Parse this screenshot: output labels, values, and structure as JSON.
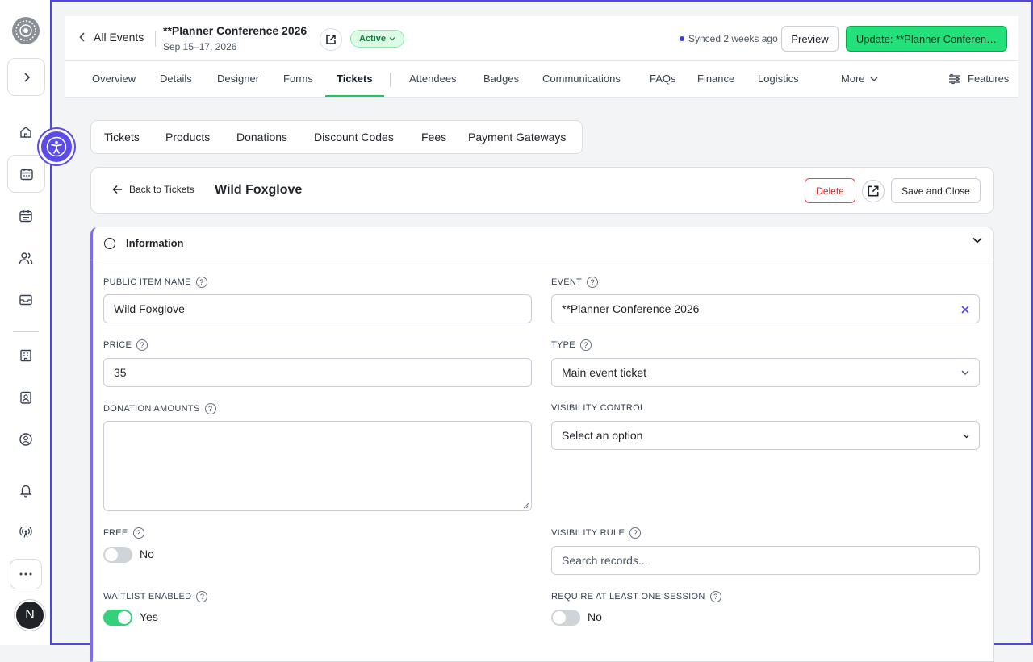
{
  "header": {
    "back_label": "All Events",
    "event_title": "**Planner Conference 2026",
    "event_dates": "Sep 15–17, 2026",
    "status": "Active",
    "synced_text": "Synced 2 weeks ago",
    "preview_label": "Preview",
    "update_label": "Update: **Planner Conferen…"
  },
  "nav": {
    "items": [
      "Overview",
      "Details",
      "Designer",
      "Forms",
      "Tickets",
      "Attendees",
      "Badges",
      "Communications",
      "FAQs",
      "Finance",
      "Logistics",
      "More"
    ],
    "active": "Tickets",
    "features_label": "Features"
  },
  "subtabs": [
    "Tickets",
    "Products",
    "Donations",
    "Discount Codes",
    "Fees",
    "Payment Gateways"
  ],
  "item_bar": {
    "back_label": "Back to Tickets",
    "title": "Wild Foxglove",
    "delete_label": "Delete",
    "save_label": "Save and Close"
  },
  "section": {
    "title": "Information"
  },
  "form": {
    "public_item_name": {
      "label": "PUBLIC ITEM NAME",
      "value": "Wild Foxglove"
    },
    "event": {
      "label": "EVENT",
      "value": "**Planner Conference 2026"
    },
    "price": {
      "label": "PRICE",
      "value": "35"
    },
    "type": {
      "label": "TYPE",
      "value": "Main event ticket"
    },
    "donation_amounts": {
      "label": "DONATION AMOUNTS",
      "value": ""
    },
    "visibility_control": {
      "label": "VISIBILITY CONTROL",
      "value": "Select an option"
    },
    "free": {
      "label": "FREE",
      "value_text": "No",
      "on": false
    },
    "visibility_rule": {
      "label": "VISIBILITY RULE",
      "placeholder": "Search records..."
    },
    "waitlist_enabled": {
      "label": "WAITLIST ENABLED",
      "value_text": "Yes",
      "on": true
    },
    "require_session": {
      "label": "REQUIRE AT LEAST ONE SESSION",
      "value_text": "No",
      "on": false
    }
  },
  "user": {
    "avatar_initial": "N"
  },
  "colors": {
    "accent": "#5b4be8",
    "primary_green": "#22e07a",
    "danger": "#dc2626",
    "toggle_on": "#34d17a"
  }
}
